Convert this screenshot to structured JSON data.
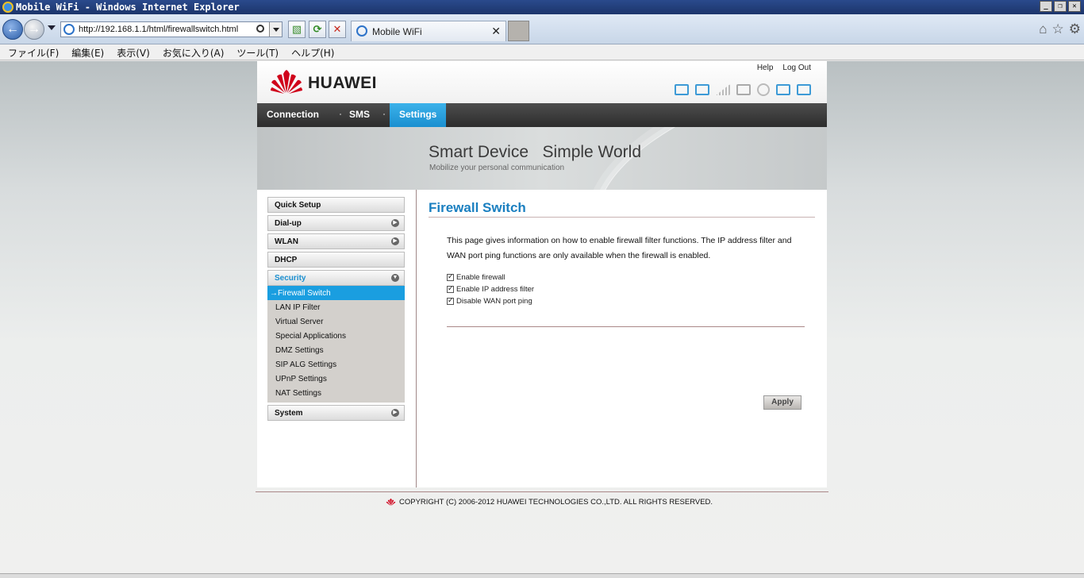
{
  "window": {
    "title": "Mobile WiFi - Windows Internet Explorer",
    "controls": [
      "_",
      "❐",
      "✕"
    ]
  },
  "browser": {
    "url": "http://192.168.1.1/html/firewallswitch.html",
    "tab_title": "Mobile WiFi",
    "tab_close": "✕"
  },
  "menubar": {
    "items": [
      "ファイル(F)",
      "編集(E)",
      "表示(V)",
      "お気に入り(A)",
      "ツール(T)",
      "ヘルプ(H)"
    ]
  },
  "header": {
    "brand": "HUAWEI",
    "help": "Help",
    "logout": "Log Out"
  },
  "nav": {
    "tabs": [
      "Connection",
      "SMS",
      "Settings"
    ],
    "active": "Settings"
  },
  "banner": {
    "slogan": "Smart Device   Simple World",
    "tagline": "Mobilize your personal communication"
  },
  "sidebar": {
    "items": [
      {
        "label": "Quick Setup"
      },
      {
        "label": "Dial-up"
      },
      {
        "label": "WLAN"
      },
      {
        "label": "DHCP"
      },
      {
        "label": "Security"
      },
      {
        "label": "System"
      }
    ],
    "security_sub": [
      "→Firewall Switch",
      "LAN IP Filter",
      "Virtual Server",
      "Special Applications",
      "DMZ Settings",
      "SIP ALG Settings",
      "UPnP Settings",
      "NAT Settings"
    ]
  },
  "content": {
    "title": "Firewall Switch",
    "description": "This page gives information on how to enable firewall filter functions. The IP address filter and WAN port ping functions are only available when the firewall is enabled.",
    "options": [
      {
        "label": "Enable firewall",
        "checked": true
      },
      {
        "label": "Enable IP address filter",
        "checked": true
      },
      {
        "label": "Disable WAN port ping",
        "checked": true
      }
    ],
    "apply_label": "Apply"
  },
  "footer": {
    "copyright": "COPYRIGHT (C) 2006-2012 HUAWEI TECHNOLOGIES CO.,LTD. ALL RIGHTS RESERVED."
  },
  "colors": {
    "accent": "#1a8fd0",
    "brand_red": "#d0021b",
    "title_blue": "#1a7fc0"
  }
}
